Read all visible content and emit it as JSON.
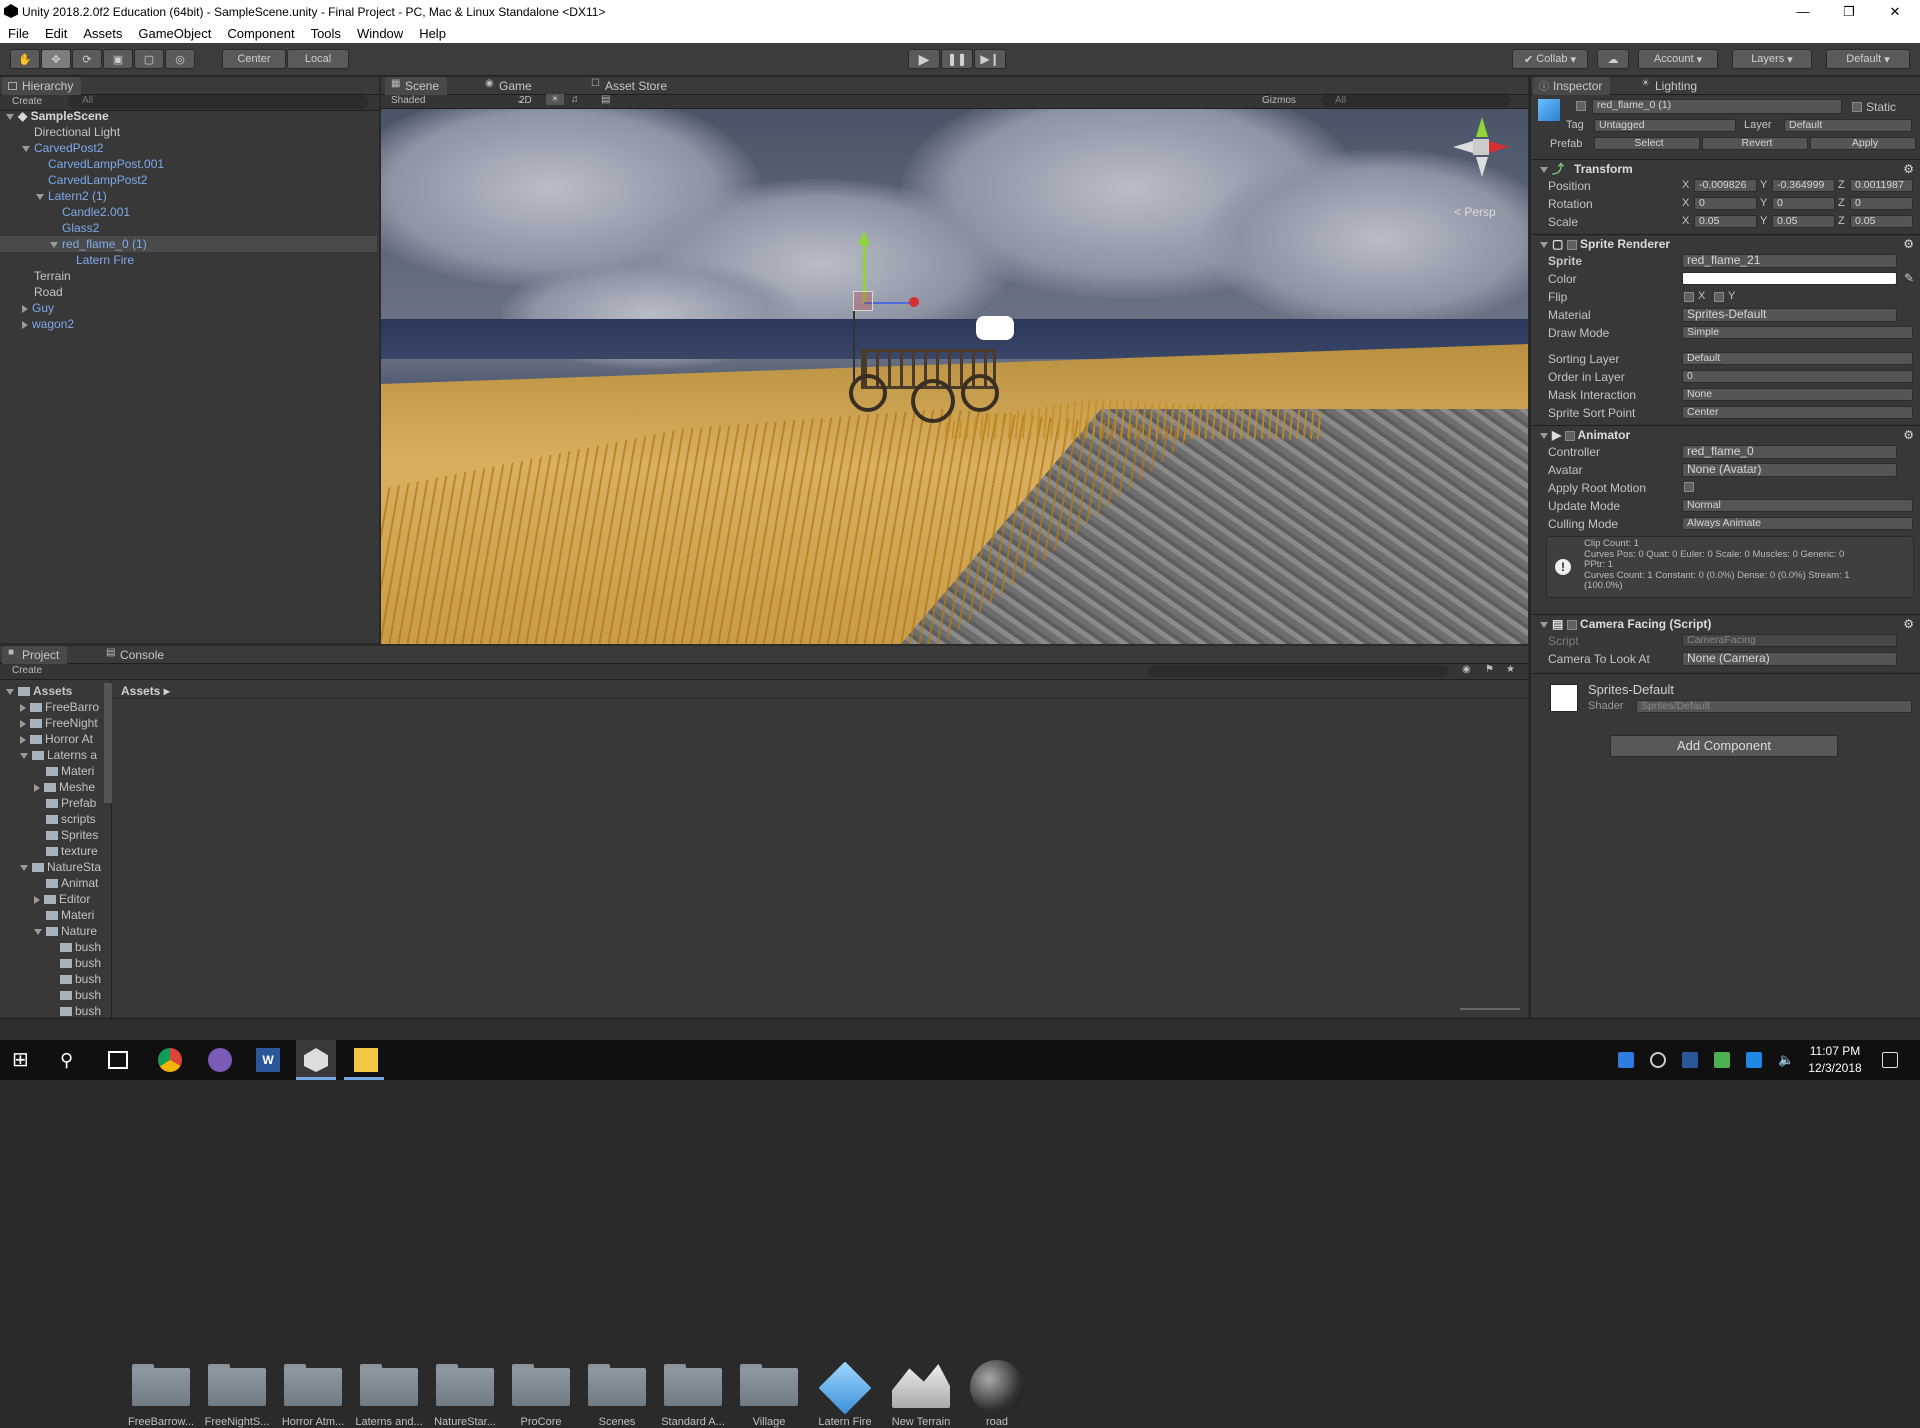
{
  "window": {
    "title": "Unity 2018.2.0f2 Education (64bit) - SampleScene.unity - Final Project - PC, Mac & Linux Standalone <DX11>"
  },
  "menu": [
    "File",
    "Edit",
    "Assets",
    "GameObject",
    "Component",
    "Tools",
    "Window",
    "Help"
  ],
  "toolbar": {
    "pivot": "Center",
    "space": "Local",
    "collab": "Collab",
    "account": "Account",
    "layers": "Layers",
    "layout": "Default"
  },
  "hierarchy": {
    "tab": "Hierarchy",
    "create": "Create",
    "search": "All",
    "scene": "SampleScene",
    "items": [
      {
        "label": "Directional Light",
        "indent": 1,
        "blue": false,
        "arrow": ""
      },
      {
        "label": "CarvedPost2",
        "indent": 1,
        "blue": true,
        "arrow": "down"
      },
      {
        "label": "CarvedLampPost.001",
        "indent": 2,
        "blue": true,
        "arrow": ""
      },
      {
        "label": "CarvedLampPost2",
        "indent": 2,
        "blue": true,
        "arrow": ""
      },
      {
        "label": "Latern2 (1)",
        "indent": 2,
        "blue": true,
        "arrow": "down"
      },
      {
        "label": "Candle2.001",
        "indent": 3,
        "blue": true,
        "arrow": ""
      },
      {
        "label": "Glass2",
        "indent": 3,
        "blue": true,
        "arrow": ""
      },
      {
        "label": "red_flame_0 (1)",
        "indent": 3,
        "blue": true,
        "arrow": "down",
        "selected": true
      },
      {
        "label": "Latern Fire",
        "indent": 4,
        "blue": true,
        "arrow": ""
      },
      {
        "label": "Terrain",
        "indent": 1,
        "blue": false,
        "arrow": ""
      },
      {
        "label": "Road",
        "indent": 1,
        "blue": false,
        "arrow": ""
      },
      {
        "label": "Guy",
        "indent": 1,
        "blue": true,
        "arrow": "right"
      },
      {
        "label": "wagon2",
        "indent": 1,
        "blue": true,
        "arrow": "right"
      }
    ]
  },
  "scene": {
    "tabs": [
      "Scene",
      "Game",
      "Asset Store"
    ],
    "shading": "Shaded",
    "mode2d": "2D",
    "gizmos": "Gizmos",
    "search": "All",
    "persp": "< Persp"
  },
  "project": {
    "tabs": [
      "Project",
      "Console"
    ],
    "create": "Create",
    "breadcrumb": "Assets",
    "tree": [
      {
        "label": "Assets",
        "indent": 0,
        "arrow": "down",
        "bold": true
      },
      {
        "label": "FreeBarro",
        "indent": 1,
        "arrow": "right"
      },
      {
        "label": "FreeNight",
        "indent": 1,
        "arrow": "right"
      },
      {
        "label": "Horror At",
        "indent": 1,
        "arrow": "right"
      },
      {
        "label": "Laterns a",
        "indent": 1,
        "arrow": "down"
      },
      {
        "label": "Materi",
        "indent": 2,
        "arrow": ""
      },
      {
        "label": "Meshe",
        "indent": 2,
        "arrow": "right"
      },
      {
        "label": "Prefab",
        "indent": 2,
        "arrow": ""
      },
      {
        "label": "scripts",
        "indent": 2,
        "arrow": ""
      },
      {
        "label": "Sprites",
        "indent": 2,
        "arrow": ""
      },
      {
        "label": "texture",
        "indent": 2,
        "arrow": ""
      },
      {
        "label": "NatureSta",
        "indent": 1,
        "arrow": "down"
      },
      {
        "label": "Animat",
        "indent": 2,
        "arrow": ""
      },
      {
        "label": "Editor",
        "indent": 2,
        "arrow": "right"
      },
      {
        "label": "Materi",
        "indent": 2,
        "arrow": ""
      },
      {
        "label": "Nature",
        "indent": 2,
        "arrow": "down"
      },
      {
        "label": "bush",
        "indent": 3,
        "arrow": ""
      },
      {
        "label": "bush",
        "indent": 3,
        "arrow": ""
      },
      {
        "label": "bush",
        "indent": 3,
        "arrow": ""
      },
      {
        "label": "bush",
        "indent": 3,
        "arrow": ""
      },
      {
        "label": "bush",
        "indent": 3,
        "arrow": ""
      }
    ],
    "assets": [
      {
        "label": "FreeBarrow...",
        "kind": "folder"
      },
      {
        "label": "FreeNightS...",
        "kind": "folder"
      },
      {
        "label": "Horror Atm...",
        "kind": "folder"
      },
      {
        "label": "Laterns and...",
        "kind": "folder"
      },
      {
        "label": "NatureStar...",
        "kind": "folder"
      },
      {
        "label": "ProCore",
        "kind": "folder"
      },
      {
        "label": "Scenes",
        "kind": "folder"
      },
      {
        "label": "Standard A...",
        "kind": "folder"
      },
      {
        "label": "Village",
        "kind": "folder"
      },
      {
        "label": "Latern Fire",
        "kind": "prefab"
      },
      {
        "label": "New Terrain",
        "kind": "terrain"
      },
      {
        "label": "road",
        "kind": "material"
      }
    ]
  },
  "inspector": {
    "tabs": [
      "Inspector",
      "Lighting"
    ],
    "object_name": "red_flame_0 (1)",
    "static": "Static",
    "tag_label": "Tag",
    "tag": "Untagged",
    "layer_label": "Layer",
    "layer": "Default",
    "prefab_label": "Prefab",
    "prefab_select": "Select",
    "prefab_revert": "Revert",
    "prefab_apply": "Apply",
    "transform": {
      "title": "Transform",
      "rows": [
        {
          "label": "Position",
          "x": "-0.009826",
          "y": "-0.364999",
          "z": "0.0011987"
        },
        {
          "label": "Rotation",
          "x": "0",
          "y": "0",
          "z": "0"
        },
        {
          "label": "Scale",
          "x": "0.05",
          "y": "0.05",
          "z": "0.05"
        }
      ]
    },
    "sprite_renderer": {
      "title": "Sprite Renderer",
      "sprite_label": "Sprite",
      "sprite": "red_flame_21",
      "color_label": "Color",
      "flip_label": "Flip",
      "flip_x": "X",
      "flip_y": "Y",
      "material_label": "Material",
      "material": "Sprites-Default",
      "draw_mode_label": "Draw Mode",
      "draw_mode": "Simple",
      "sorting_layer_label": "Sorting Layer",
      "sorting_layer": "Default",
      "order_label": "Order in Layer",
      "order": "0",
      "mask_label": "Mask Interaction",
      "mask": "None",
      "sort_point_label": "Sprite Sort Point",
      "sort_point": "Center"
    },
    "animator": {
      "title": "Animator",
      "controller_label": "Controller",
      "controller": "red_flame_0",
      "avatar_label": "Avatar",
      "avatar": "None (Avatar)",
      "root_motion_label": "Apply Root Motion",
      "update_mode_label": "Update Mode",
      "update_mode": "Normal",
      "culling_label": "Culling Mode",
      "culling": "Always Animate",
      "info": [
        "Clip Count: 1",
        "Curves Pos: 0 Quat: 0 Euler: 0 Scale: 0 Muscles: 0 Generic: 0",
        "PPtr: 1",
        "Curves Count: 1 Constant: 0 (0.0%) Dense: 0 (0.0%) Stream: 1",
        "(100.0%)"
      ]
    },
    "camera_facing": {
      "title": "Camera Facing (Script)",
      "script_label": "Script",
      "script": "CameraFacing",
      "camera_label": "Camera To Look At",
      "camera": "None (Camera)"
    },
    "material": {
      "name": "Sprites-Default",
      "shader_label": "Shader",
      "shader": "Sprites/Default"
    },
    "add_component": "Add Component"
  },
  "taskbar": {
    "time": "11:07 PM",
    "date": "12/3/2018"
  },
  "colors": {
    "selection": "#3e5f96",
    "panel": "#383838",
    "scene_ground": "#c8a048"
  }
}
